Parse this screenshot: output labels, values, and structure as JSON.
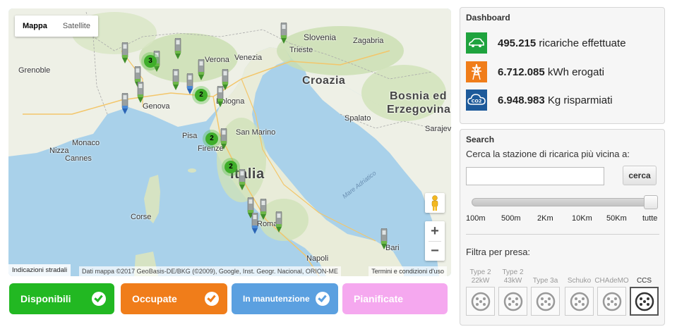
{
  "map": {
    "type_control": {
      "map_label": "Mappa",
      "satellite_label": "Satellite"
    },
    "labels": {
      "slovenia": "Slovenia",
      "zagabria": "Zagabria",
      "trieste": "Trieste",
      "verona": "Verona",
      "venezia": "Venezia",
      "grenoble": "Grenoble",
      "genova": "Genova",
      "monaco": "Monaco",
      "nizza": "Nizza",
      "cannes": "Cannes",
      "san_marino": "San Marino",
      "firenze": "Firenze",
      "pisa": "Pisa",
      "stazione": "Bologna",
      "italia": "Italia",
      "croazia": "Croazia",
      "bosnia": "Bosnia ed",
      "erzegovina": "Erzegovina",
      "spalato": "Spalato",
      "sarajevo": "Sarajevo",
      "mare_adriatico": "Mare Adriatico",
      "corse": "Corse",
      "roma": "Roma",
      "napoli": "Napoli",
      "bari": "Bari"
    },
    "clusters": [
      "3",
      "2",
      "2",
      "2"
    ],
    "footer": {
      "indications": "Indicazioni stradali",
      "credits": "Dati mappa ©2017 GeoBasis-DE/BKG (©2009), Google, Inst. Geogr. Nacional, ORION-ME",
      "terms": "Termini e condizioni d'uso"
    },
    "zoom": {
      "in": "+",
      "out": "−"
    }
  },
  "status_filters": [
    {
      "label": "Disponibili",
      "color": "#22b822"
    },
    {
      "label": "Occupate",
      "color": "#f07d1a"
    },
    {
      "label": "In manutenzione",
      "color": "#5ba0e0"
    },
    {
      "label": "Pianificate",
      "color": "#f5a8ef"
    }
  ],
  "dashboard": {
    "title": "Dashboard",
    "stats": [
      {
        "value": "495.215",
        "unit": "ricariche effettuate",
        "icon": "car-icon",
        "color": "#1fa33e"
      },
      {
        "value": "6.712.085",
        "unit": "kWh erogati",
        "icon": "power-tower-icon",
        "color": "#f07d1a"
      },
      {
        "value": "6.948.983",
        "unit": "Kg risparmiati",
        "icon": "co2-cloud-icon",
        "color": "#1d5a9a"
      }
    ]
  },
  "search": {
    "title": "Search",
    "subtitle": "Cerca la stazione di ricarica più vicina a:",
    "input_value": "",
    "button_label": "cerca",
    "slider_ticks": [
      "100m",
      "500m",
      "2Km",
      "10Km",
      "50Km",
      "tutte"
    ],
    "slider_value": "tutte",
    "filter_title": "Filtra per presa:",
    "plugs": [
      {
        "name_line1": "Type 2",
        "name_line2": "22kW",
        "selected": false
      },
      {
        "name_line1": "Type 2",
        "name_line2": "43kW",
        "selected": false
      },
      {
        "name_line1": "Type 3a",
        "name_line2": "",
        "selected": false
      },
      {
        "name_line1": "Schuko",
        "name_line2": "",
        "selected": false
      },
      {
        "name_line1": "CHAdeMO",
        "name_line2": "",
        "selected": false
      },
      {
        "name_line1": "CCS",
        "name_line2": "",
        "selected": true
      }
    ]
  }
}
